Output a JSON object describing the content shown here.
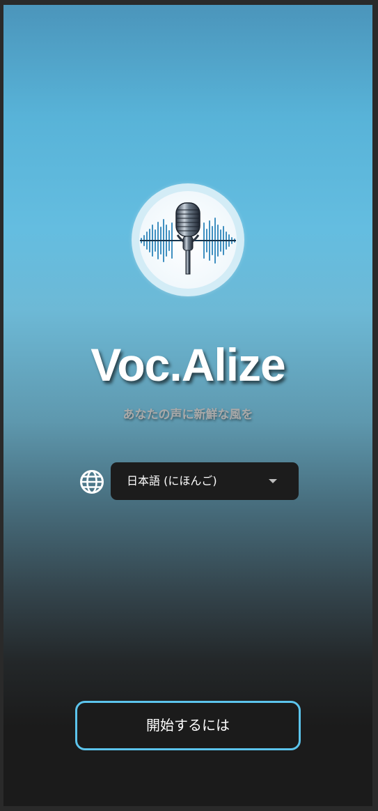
{
  "app": {
    "title": "Voc.Alize",
    "tagline": "あなたの声に新鮮な風を"
  },
  "logo": {
    "icon": "microphone-soundwave-logo"
  },
  "language": {
    "icon": "globe-icon",
    "selected": "日本語 (にほんご)"
  },
  "actions": {
    "start_label": "開始するには"
  },
  "colors": {
    "accent": "#5cc4ec",
    "control_bg": "#1c1c1c",
    "page_bottom": "#1b1b1b"
  }
}
